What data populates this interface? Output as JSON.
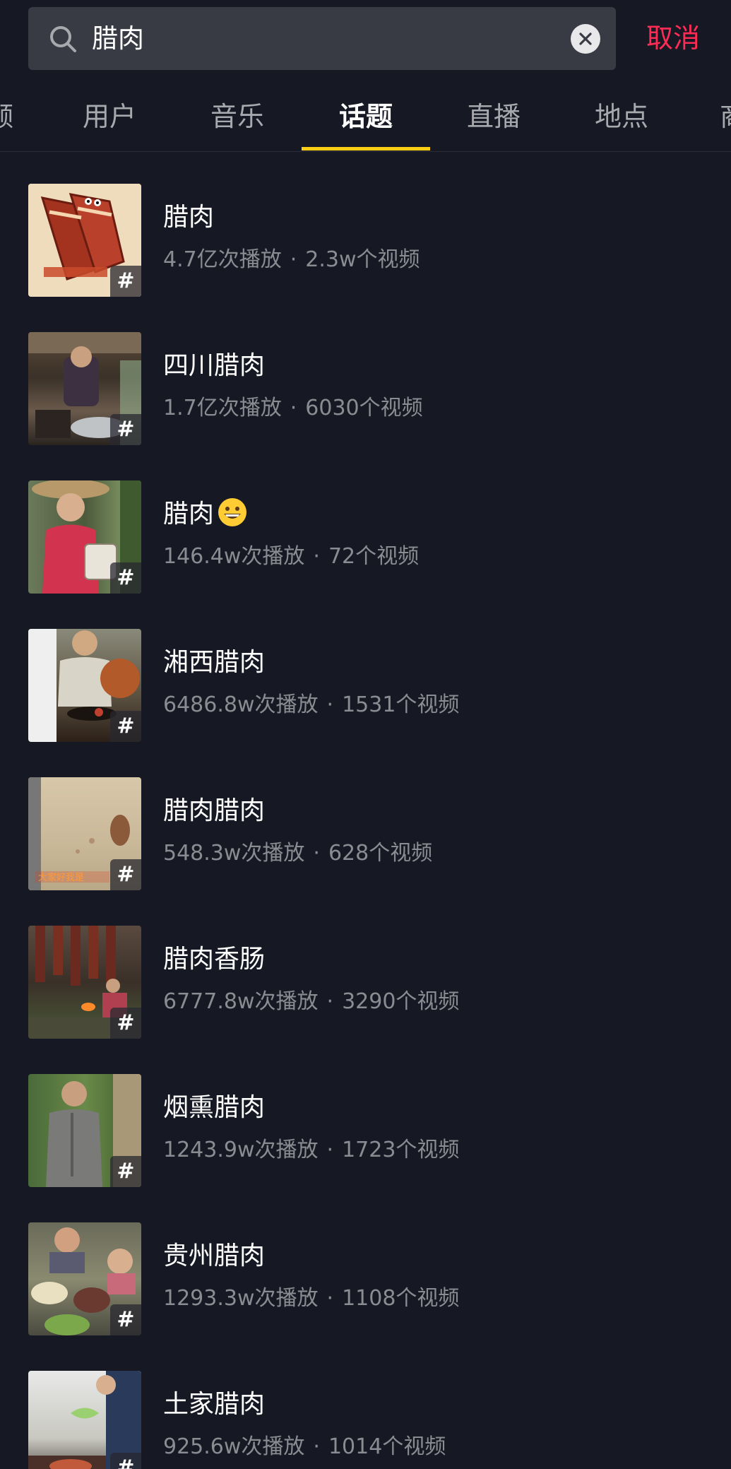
{
  "search": {
    "query": "腊肉",
    "cancel_label": "取消"
  },
  "tabs": [
    {
      "label": "频"
    },
    {
      "label": "用户"
    },
    {
      "label": "音乐"
    },
    {
      "label": "话题"
    },
    {
      "label": "直播"
    },
    {
      "label": "地点"
    },
    {
      "label": "商"
    }
  ],
  "active_tab": "话题",
  "topics": [
    {
      "title": "腊肉",
      "plays": "4.7亿次播放",
      "videos": "2.3w个视频",
      "thumb_text": "腊肉"
    },
    {
      "title": "四川腊肉",
      "plays": "1.7亿次播放",
      "videos": "6030个视频",
      "thumb_text": ""
    },
    {
      "title": "腊肉",
      "emoji": "grinning-face-emoji",
      "plays": "146.4w次播放",
      "videos": "72个视频",
      "thumb_text": ""
    },
    {
      "title": "湘西腊肉",
      "plays": "6486.8w次播放",
      "videos": "1531个视频",
      "thumb_text": ""
    },
    {
      "title": "腊肉腊肉",
      "plays": "548.3w次播放",
      "videos": "628个视频",
      "thumb_text": "大家好我是"
    },
    {
      "title": "腊肉香肠",
      "plays": "6777.8w次播放",
      "videos": "3290个视频",
      "thumb_text": ""
    },
    {
      "title": "烟熏腊肉",
      "plays": "1243.9w次播放",
      "videos": "1723个视频",
      "thumb_text": ""
    },
    {
      "title": "贵州腊肉",
      "plays": "1293.3w次播放",
      "videos": "1108个视频",
      "thumb_text": ""
    },
    {
      "title": "土家腊肉",
      "plays": "925.6w次播放",
      "videos": "1014个视频",
      "thumb_text": ""
    }
  ],
  "badge_symbol": "#",
  "stats_separator": "·",
  "colors": {
    "background": "#161823",
    "search_bg": "#393b44",
    "cancel": "#fe2c55",
    "tab_indicator": "#face15",
    "muted_text": "#8b8c92"
  }
}
